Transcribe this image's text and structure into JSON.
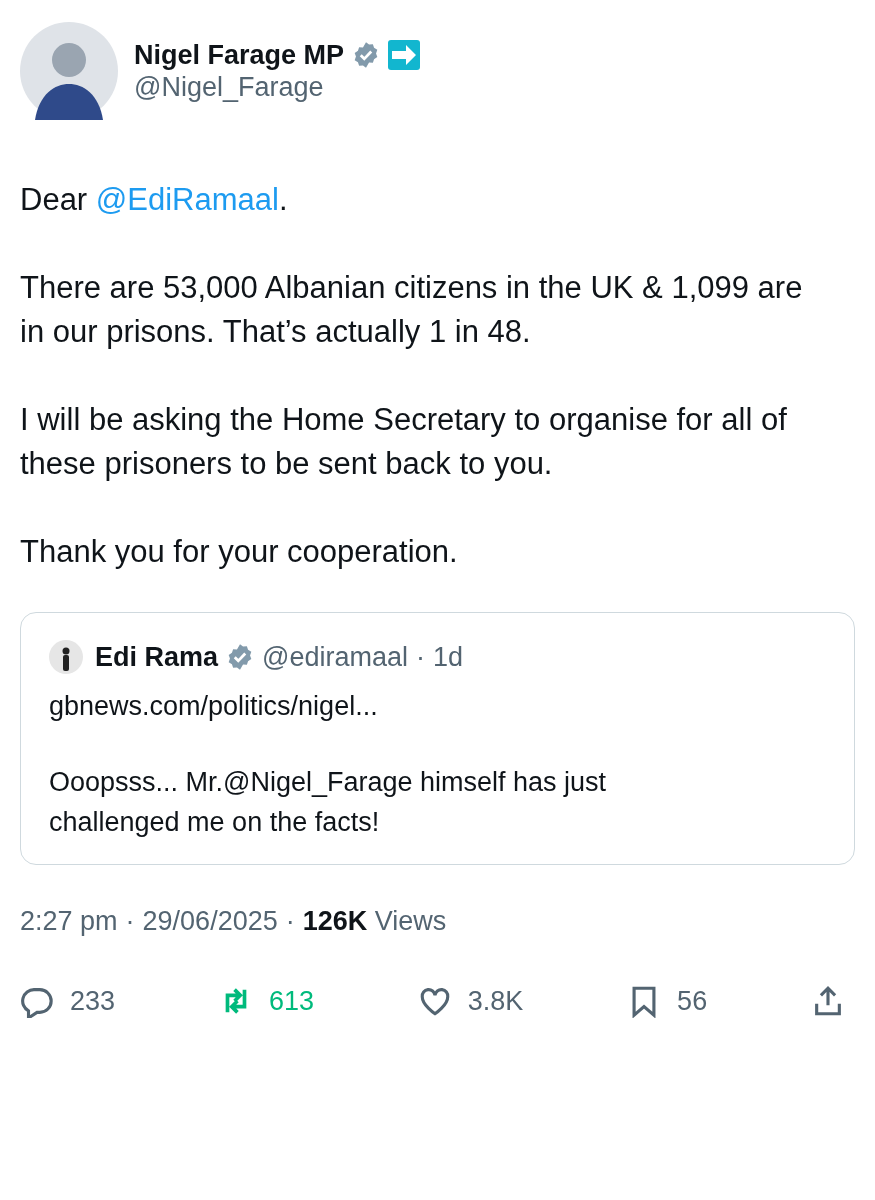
{
  "author": {
    "name": "Nigel Farage MP",
    "handle": "@Nigel_Farage",
    "verified": true
  },
  "body": [
    [
      {
        "text": "Dear "
      },
      {
        "text": "@EdiRamaal",
        "kind": "mention"
      },
      {
        "text": "."
      }
    ],
    [
      {
        "text": "There are 53,000 Albanian citizens in the UK & 1,099 are in our prisons. That’s actually 1 in 48."
      }
    ],
    [
      {
        "text": "I will be asking the Home Secretary to organise for all of these prisoners to be sent back to you."
      }
    ],
    [
      {
        "text": "Thank you for your cooperation."
      }
    ]
  ],
  "quote": {
    "name": "Edi Rama",
    "verified": true,
    "handle": "@ediramaal",
    "separator": "·",
    "age": "1d",
    "link": "gbnews.com/politics/nigel...",
    "text": "Ooopsss... Mr.@Nigel_Farage himself has just challenged me on the facts!"
  },
  "meta": {
    "time": "2:27 pm",
    "separator": "·",
    "date": "29/06/2025",
    "views_count": "126K",
    "views_label": "Views"
  },
  "actions": [
    {
      "kind": "reply",
      "count": "233",
      "active": false
    },
    {
      "kind": "repost",
      "count": "613",
      "active": true
    },
    {
      "kind": "like",
      "count": "3.8K",
      "active": false
    },
    {
      "kind": "bookmark",
      "count": "56",
      "active": false
    },
    {
      "kind": "share",
      "active": false
    }
  ]
}
